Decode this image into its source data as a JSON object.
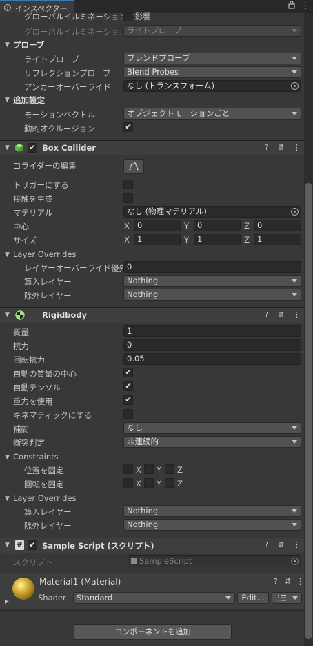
{
  "tab": {
    "title": "インスペクター"
  },
  "lighting": {
    "gi_affect_label": "グローバルイルミネーションに影響",
    "gi_receive_label": "グローバルイルミネーションを受け取る",
    "gi_receive_value": "ライトプローブ"
  },
  "probes": {
    "header": "プローブ",
    "light_probes_label": "ライトプローブ",
    "light_probes_value": "ブレンドプローブ",
    "reflection_probes_label": "リフレクションプローブ",
    "reflection_probes_value": "Blend Probes",
    "anchor_override_label": "アンカーオーバーライド",
    "anchor_override_value": "なし (トランスフォーム)"
  },
  "additional": {
    "header": "追加設定",
    "motion_vectors_label": "モーションベクトル",
    "motion_vectors_value": "オブジェクトモーションごと",
    "dynamic_occlusion_label": "動的オクルージョン",
    "dynamic_occlusion_checked": true
  },
  "box_collider": {
    "title": "Box Collider",
    "enabled": true,
    "edit_label": "コライダーの編集",
    "trigger_label": "トリガーにする",
    "trigger_checked": false,
    "contacts_label": "接触を生成",
    "contacts_checked": false,
    "material_label": "マテリアル",
    "material_value": "なし (物理マテリアル)",
    "center_label": "中心",
    "center": {
      "x": "0",
      "y": "0",
      "z": "0"
    },
    "size_label": "サイズ",
    "size": {
      "x": "1",
      "y": "1",
      "z": "1"
    },
    "layer_overrides": {
      "header": "Layer Overrides",
      "priority_label": "レイヤーオーバーライド優先度",
      "priority_value": "0",
      "include_label": "算入レイヤー",
      "include_value": "Nothing",
      "exclude_label": "除外レイヤー",
      "exclude_value": "Nothing"
    }
  },
  "rigidbody": {
    "title": "Rigidbody",
    "mass_label": "質量",
    "mass_value": "1",
    "drag_label": "抗力",
    "drag_value": "0",
    "angular_drag_label": "回転抗力",
    "angular_drag_value": "0.05",
    "auto_center_label": "自動の質量の中心",
    "auto_center_checked": true,
    "auto_tensor_label": "自動テンソル",
    "auto_tensor_checked": true,
    "gravity_label": "重力を使用",
    "gravity_checked": true,
    "kinematic_label": "キネマティックにする",
    "kinematic_checked": false,
    "interpolate_label": "補間",
    "interpolate_value": "なし",
    "collision_label": "衝突判定",
    "collision_value": "非連続的",
    "constraints": {
      "header": "Constraints",
      "position_label": "位置を固定",
      "rotation_label": "回転を固定",
      "x": "X",
      "y": "Y",
      "z": "Z"
    },
    "layer_overrides": {
      "header": "Layer Overrides",
      "include_label": "算入レイヤー",
      "include_value": "Nothing",
      "exclude_label": "除外レイヤー",
      "exclude_value": "Nothing"
    }
  },
  "sample_script": {
    "title": "Sample Script (スクリプト)",
    "enabled": true,
    "script_label": "スクリプト",
    "script_value": "SampleScript"
  },
  "material": {
    "title": "Material1 (Material)",
    "shader_label": "Shader",
    "shader_value": "Standard",
    "edit_button": "Edit..."
  },
  "add_component_button": "コンポーネントを追加",
  "axis": {
    "x": "X",
    "y": "Y",
    "z": "Z"
  },
  "icons": {
    "help": "?",
    "settings": "⇵",
    "menu": "⋮",
    "lock": "lock-icon",
    "pick": "◎"
  }
}
